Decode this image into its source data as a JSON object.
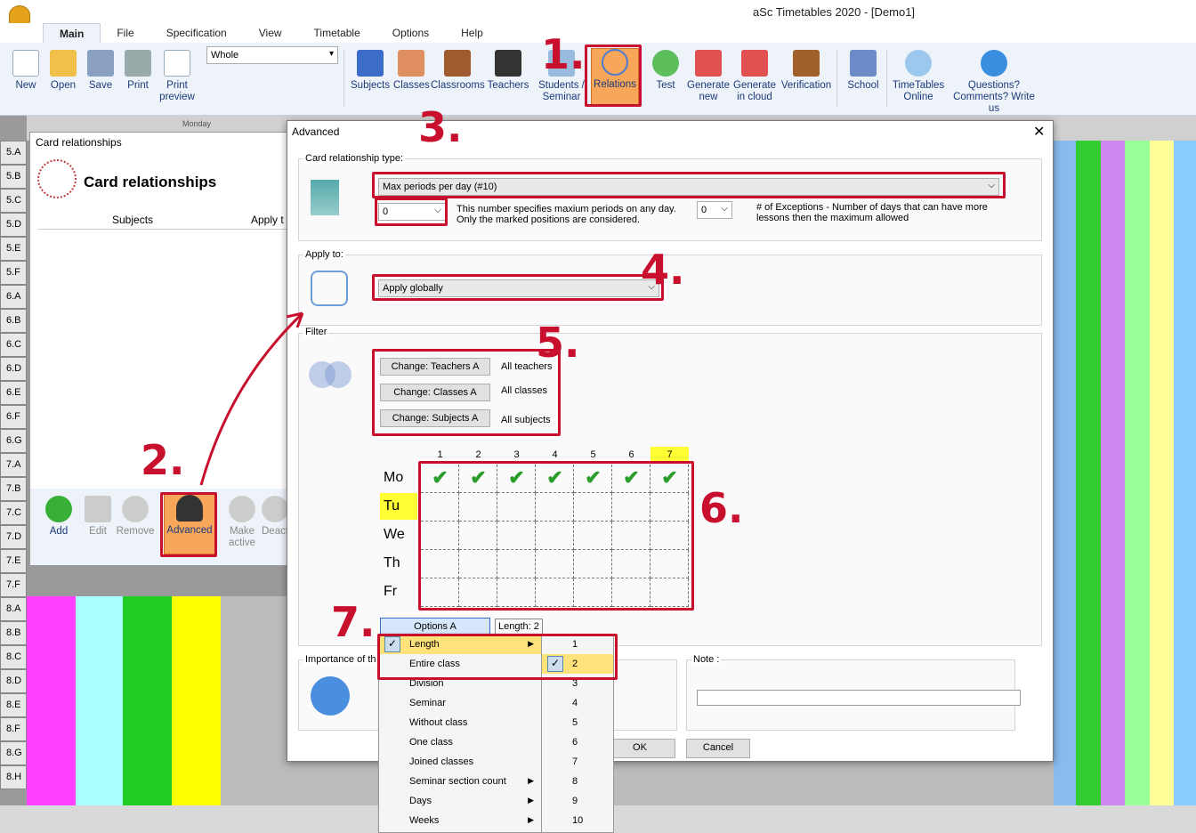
{
  "app": {
    "title": "aSc Timetables 2020  - [Demo1]"
  },
  "menu": [
    "Main",
    "File",
    "Specification",
    "View",
    "Timetable",
    "Options",
    "Help"
  ],
  "ribbon": {
    "new": "New",
    "open": "Open",
    "save": "Save",
    "print": "Print",
    "print_preview": "Print preview",
    "view_select": "Whole",
    "subjects": "Subjects",
    "classes": "Classes",
    "classrooms": "Classrooms",
    "teachers": "Teachers",
    "students": "Students / Seminar",
    "relations": "Relations",
    "test": "Test",
    "generate_new": "Generate new",
    "generate_cloud": "Generate in cloud",
    "verification": "Verification",
    "school": "School",
    "tt_online": "TimeTables Online",
    "questions": "Questions? Comments? Write us"
  },
  "grid": {
    "day_header": "Monday",
    "rows": [
      "5.A",
      "5.B",
      "5.C",
      "5.D",
      "5.E",
      "5.F",
      "6.A",
      "6.B",
      "6.C",
      "6.D",
      "6.E",
      "6.F",
      "6.G",
      "7.A",
      "7.B",
      "7.C",
      "7.D",
      "7.E",
      "7.F",
      "8.A",
      "8.B",
      "8.C",
      "8.D",
      "8.E",
      "8.F",
      "8.G",
      "8.H"
    ]
  },
  "card_rel": {
    "window_title": "Card relationships",
    "heading": "Card relationships",
    "col_subjects": "Subjects",
    "col_apply": "Apply t",
    "add": "Add",
    "edit": "Edit",
    "remove": "Remove",
    "advanced": "Advanced",
    "make_active": "Make active",
    "deact": "Deact"
  },
  "adv": {
    "title": "Advanced",
    "type_label": "Card relationship type:",
    "type_value": "Max periods per day (#10)",
    "max_value": "0",
    "max_desc": "This number specifies maxium periods on any day. Only the marked positions are considered.",
    "exc_value": "0",
    "exc_desc": "# of Exceptions - Number of days that can have more lessons then the maximum allowed",
    "apply_label": "Apply to:",
    "apply_value": "Apply globally",
    "filter_label": "Filter",
    "btn_teachers": "Change: Teachers A",
    "all_teachers": "All teachers",
    "btn_classes": "Change: Classes A",
    "all_classes": "All classes",
    "btn_subjects": "Change: Subjects A",
    "all_subjects": "All subjects",
    "periods": [
      "1",
      "2",
      "3",
      "4",
      "5",
      "6",
      "7"
    ],
    "days": [
      "Mo",
      "Tu",
      "We",
      "Th",
      "Fr"
    ],
    "options_btn": "Options A",
    "length_badge": "Length: 2",
    "importance": "Importance of th",
    "note_label": "Note :",
    "ok": "OK",
    "cancel": "Cancel"
  },
  "context_menu": [
    "Length",
    "Entire class",
    "Division",
    "Seminar",
    "Without class",
    "One class",
    "Joined classes",
    "Seminar section count",
    "Days",
    "Weeks"
  ],
  "length_submenu": [
    "1",
    "2",
    "3",
    "4",
    "5",
    "6",
    "7",
    "8",
    "9",
    "10"
  ],
  "annotations": [
    "1.",
    "2.",
    "3.",
    "4.",
    "5.",
    "6.",
    "7."
  ]
}
